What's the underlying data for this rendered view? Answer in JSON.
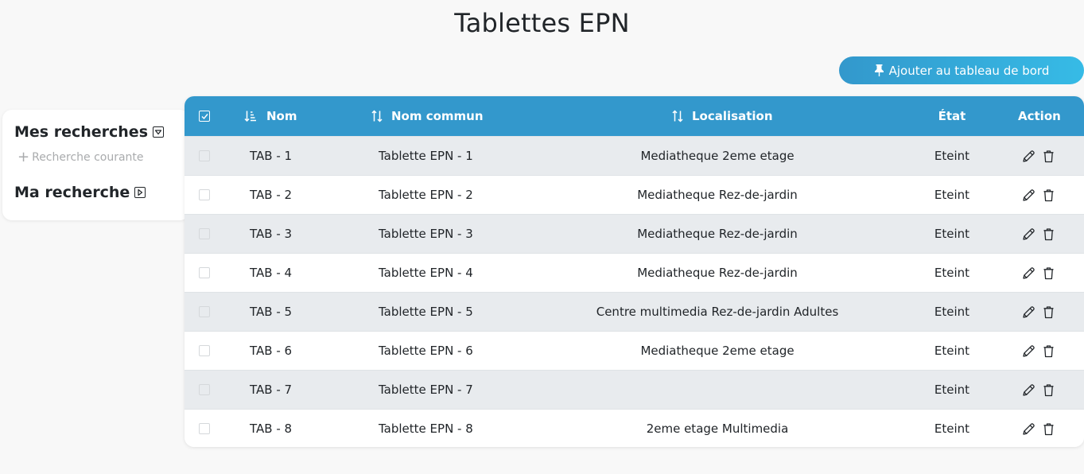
{
  "page": {
    "title": "Tablettes EPN"
  },
  "toolbar": {
    "pin_label": "Ajouter au tableau de bord",
    "pin_icon": "pin-icon"
  },
  "sidebar": {
    "saved_searches_title": "Mes recherches",
    "add_current_label": "Recherche courante",
    "my_search_title": "Ma recherche"
  },
  "table": {
    "columns": {
      "nom": "Nom",
      "nom_commun": "Nom commun",
      "localisation": "Localisation",
      "etat": "État",
      "action": "Action"
    },
    "rows": [
      {
        "nom": "TAB - 1",
        "nom_commun": "Tablette EPN - 1",
        "localisation": "Mediatheque 2eme etage",
        "etat": "Eteint"
      },
      {
        "nom": "TAB - 2",
        "nom_commun": "Tablette EPN - 2",
        "localisation": "Mediatheque Rez-de-jardin",
        "etat": "Eteint"
      },
      {
        "nom": "TAB - 3",
        "nom_commun": "Tablette EPN - 3",
        "localisation": "Mediatheque Rez-de-jardin",
        "etat": "Eteint"
      },
      {
        "nom": "TAB - 4",
        "nom_commun": "Tablette EPN - 4",
        "localisation": "Mediatheque Rez-de-jardin",
        "etat": "Eteint"
      },
      {
        "nom": "TAB - 5",
        "nom_commun": "Tablette EPN - 5",
        "localisation": "Centre multimedia Rez-de-jardin Adultes",
        "etat": "Eteint"
      },
      {
        "nom": "TAB - 6",
        "nom_commun": "Tablette EPN - 6",
        "localisation": "Mediatheque 2eme etage",
        "etat": "Eteint"
      },
      {
        "nom": "TAB - 7",
        "nom_commun": "Tablette EPN - 7",
        "localisation": "",
        "etat": "Eteint"
      },
      {
        "nom": "TAB - 8",
        "nom_commun": "Tablette EPN - 8",
        "localisation": "2eme etage Multimedia",
        "etat": "Eteint"
      }
    ]
  },
  "colors": {
    "header": "#3398cc",
    "accent_end": "#36bbe6",
    "row_alt": "#e8ebee"
  }
}
